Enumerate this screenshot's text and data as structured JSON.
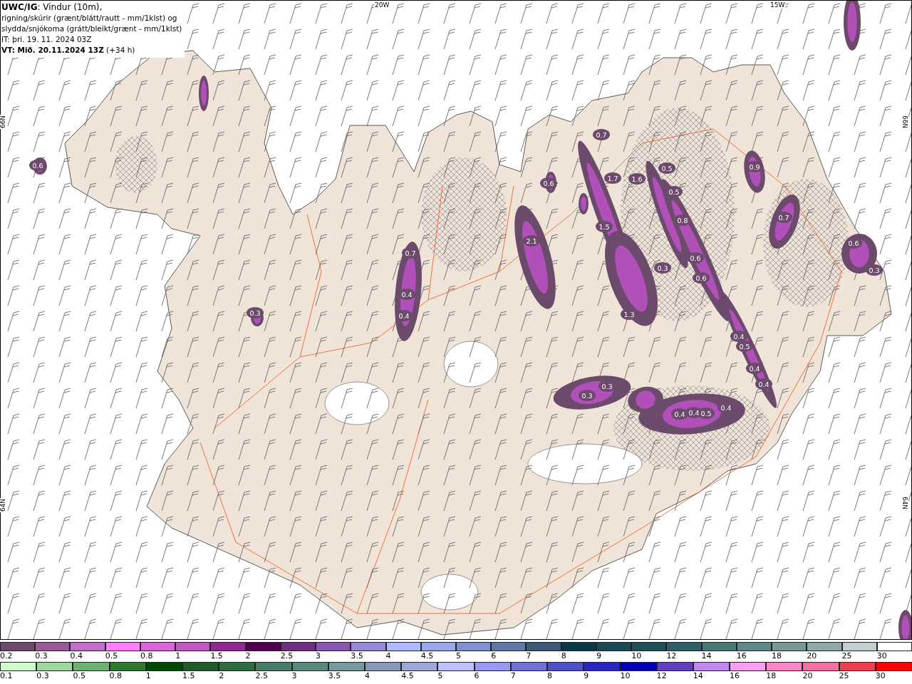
{
  "title": {
    "lines": [
      "**UWC/IG**: Vindur (10m),",
      "rigning/skúrir (grænt/blátt/rautt - mm/1klst) og",
      "slydda/snjókoma (grátt/bleikt/grænt - mm/1klst)",
      "IT: þri. 19. 11. 2024 03Z",
      "**VT: Mið. 20.11.2024 13Z** (+34 h)"
    ]
  },
  "axis_labels": {
    "top": [
      "20W",
      "15W"
    ],
    "left": [
      "66N",
      "64N"
    ],
    "right": [
      "66N",
      "64N"
    ]
  },
  "precip_values": [
    "0.7",
    "0.4",
    "0.4",
    "2.1",
    "1.5",
    "1.3",
    "0.6",
    "0.3",
    "0.7",
    "0.9",
    "0.3",
    "0.3",
    "0.4",
    "0.4",
    "0.5",
    "0.4",
    "0.5",
    "0.5",
    "0.8",
    "0.6",
    "0.6",
    "0.3",
    "0.4",
    "0.5",
    "0.4",
    "0.4",
    "0.6",
    "0.3",
    "1.6",
    "0.7",
    "1.7",
    "0.6"
  ],
  "legend": {
    "rows": [
      {
        "items": [
          {
            "label": "0.2",
            "color": "#6b4a6b"
          },
          {
            "label": "0.3",
            "color": "#9a5a9a"
          },
          {
            "label": "0.4",
            "color": "#c070c8"
          },
          {
            "label": "0.5",
            "color": "#ff80ff"
          },
          {
            "label": "0.8",
            "color": "#d868d8"
          },
          {
            "label": "1",
            "color": "#c058c0"
          },
          {
            "label": "1.5",
            "color": "#902a90"
          },
          {
            "label": "2",
            "color": "#500050"
          },
          {
            "label": "2.5",
            "color": "#703080"
          },
          {
            "label": "3",
            "color": "#8858b0"
          },
          {
            "label": "3.5",
            "color": "#9888d8"
          },
          {
            "label": "4",
            "color": "#b0b8ff"
          },
          {
            "label": "4.5",
            "color": "#98a8e8"
          },
          {
            "label": "5",
            "color": "#8090d0"
          },
          {
            "label": "6",
            "color": "#6078a8"
          },
          {
            "label": "7",
            "color": "#3a5a78"
          },
          {
            "label": "8",
            "color": "#0a3a48"
          },
          {
            "label": "9",
            "color": "#1a4a55"
          },
          {
            "label": "10",
            "color": "#205058"
          },
          {
            "label": "12",
            "color": "#306068"
          },
          {
            "label": "14",
            "color": "#487878"
          },
          {
            "label": "16",
            "color": "#608888"
          },
          {
            "label": "18",
            "color": "#789898"
          },
          {
            "label": "20",
            "color": "#90a8a8"
          },
          {
            "label": "25",
            "color": "#c0d0d0"
          },
          {
            "label": "30",
            "color": "#ffffff"
          }
        ]
      },
      {
        "items": [
          {
            "label": "0.1",
            "color": "#ccffcc"
          },
          {
            "label": "0.3",
            "color": "#a0d8a0"
          },
          {
            "label": "0.5",
            "color": "#70b070"
          },
          {
            "label": "0.8",
            "color": "#307830"
          },
          {
            "label": "1",
            "color": "#004800"
          },
          {
            "label": "1.5",
            "color": "#205a28"
          },
          {
            "label": "2",
            "color": "#306a40"
          },
          {
            "label": "2.5",
            "color": "#4a7a68"
          },
          {
            "label": "3",
            "color": "#5a8880"
          },
          {
            "label": "3.5",
            "color": "#7898a0"
          },
          {
            "label": "4",
            "color": "#8898b8"
          },
          {
            "label": "4.5",
            "color": "#a0a8d8"
          },
          {
            "label": "5",
            "color": "#c0c0ff"
          },
          {
            "label": "6",
            "color": "#9898f0"
          },
          {
            "label": "7",
            "color": "#7070d8"
          },
          {
            "label": "8",
            "color": "#5050c8"
          },
          {
            "label": "9",
            "color": "#2828c0"
          },
          {
            "label": "10",
            "color": "#0000b0"
          },
          {
            "label": "12",
            "color": "#6040c0"
          },
          {
            "label": "14",
            "color": "#c088e8"
          },
          {
            "label": "16",
            "color": "#f8a0f0"
          },
          {
            "label": "18",
            "color": "#f888c8"
          },
          {
            "label": "20",
            "color": "#f070a0"
          },
          {
            "label": "25",
            "color": "#f04050"
          },
          {
            "label": "30",
            "color": "#ff0000"
          }
        ]
      }
    ]
  }
}
